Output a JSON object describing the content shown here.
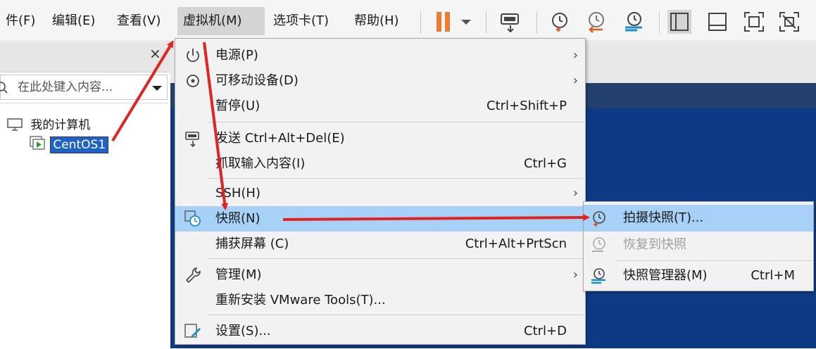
{
  "menubar": {
    "items": [
      {
        "label": "件(F)"
      },
      {
        "label": "编辑(E)"
      },
      {
        "label": "查看(V)"
      },
      {
        "label": "虚拟机(M)"
      },
      {
        "label": "选项卡(T)"
      },
      {
        "label": "帮助(H)"
      }
    ]
  },
  "toolbar": {
    "icons": [
      "pause-icon",
      "dropdown-arrow-icon",
      "send-ctrl-alt-del-icon",
      "take-snapshot-icon",
      "revert-snapshot-icon",
      "snapshot-manager-icon",
      "library-view-icon",
      "console-view-icon",
      "fullscreen-icon",
      "unity-icon"
    ],
    "accent": "#f07c30"
  },
  "library": {
    "close_glyph": "×",
    "search_placeholder": "在此处键入内容...",
    "tree": {
      "root_label": "我的计算机",
      "vm_label": "CentOS1"
    }
  },
  "menu": {
    "items": [
      {
        "label": "电源(P)",
        "shortcut": "",
        "submenu": true,
        "icon": "power-icon"
      },
      {
        "label": "可移动设备(D)",
        "shortcut": "",
        "submenu": true,
        "icon": "disc-icon"
      },
      {
        "label": "暂停(U)",
        "shortcut": "Ctrl+Shift+P",
        "submenu": false,
        "icon": ""
      },
      {
        "label": "发送 Ctrl+Alt+Del(E)",
        "shortcut": "",
        "submenu": false,
        "icon": "send-keys-icon"
      },
      {
        "label": "抓取输入内容(I)",
        "shortcut": "Ctrl+G",
        "submenu": false,
        "icon": ""
      },
      {
        "label": "SSH(H)",
        "shortcut": "",
        "submenu": true,
        "icon": ""
      },
      {
        "label": "快照(N)",
        "shortcut": "",
        "submenu": false,
        "icon": "snapshot-icon",
        "highlighted": true
      },
      {
        "label": "捕获屏幕 (C)",
        "shortcut": "Ctrl+Alt+PrtScn",
        "submenu": false,
        "icon": ""
      },
      {
        "label": "管理(M)",
        "shortcut": "",
        "submenu": true,
        "icon": "wrench-icon"
      },
      {
        "label": "重新安装 VMware Tools(T)...",
        "shortcut": "",
        "submenu": false,
        "icon": ""
      },
      {
        "label": "设置(S)...",
        "shortcut": "Ctrl+D",
        "submenu": false,
        "icon": "settings-icon"
      }
    ],
    "arrow_glyph": "›"
  },
  "submenu": {
    "items": [
      {
        "label": "拍摄快照(T)...",
        "shortcut": "",
        "highlighted": true,
        "disabled": false
      },
      {
        "label": "恢复到快照",
        "shortcut": "",
        "highlighted": false,
        "disabled": true
      },
      {
        "label": "快照管理器(M)",
        "shortcut": "Ctrl+M",
        "highlighted": false,
        "disabled": false
      }
    ]
  },
  "colors": {
    "highlight": "#a7d1f7",
    "selection": "#1e63c5",
    "vm_background": "#0e3a85",
    "annotation_arrow": "#e32222"
  }
}
